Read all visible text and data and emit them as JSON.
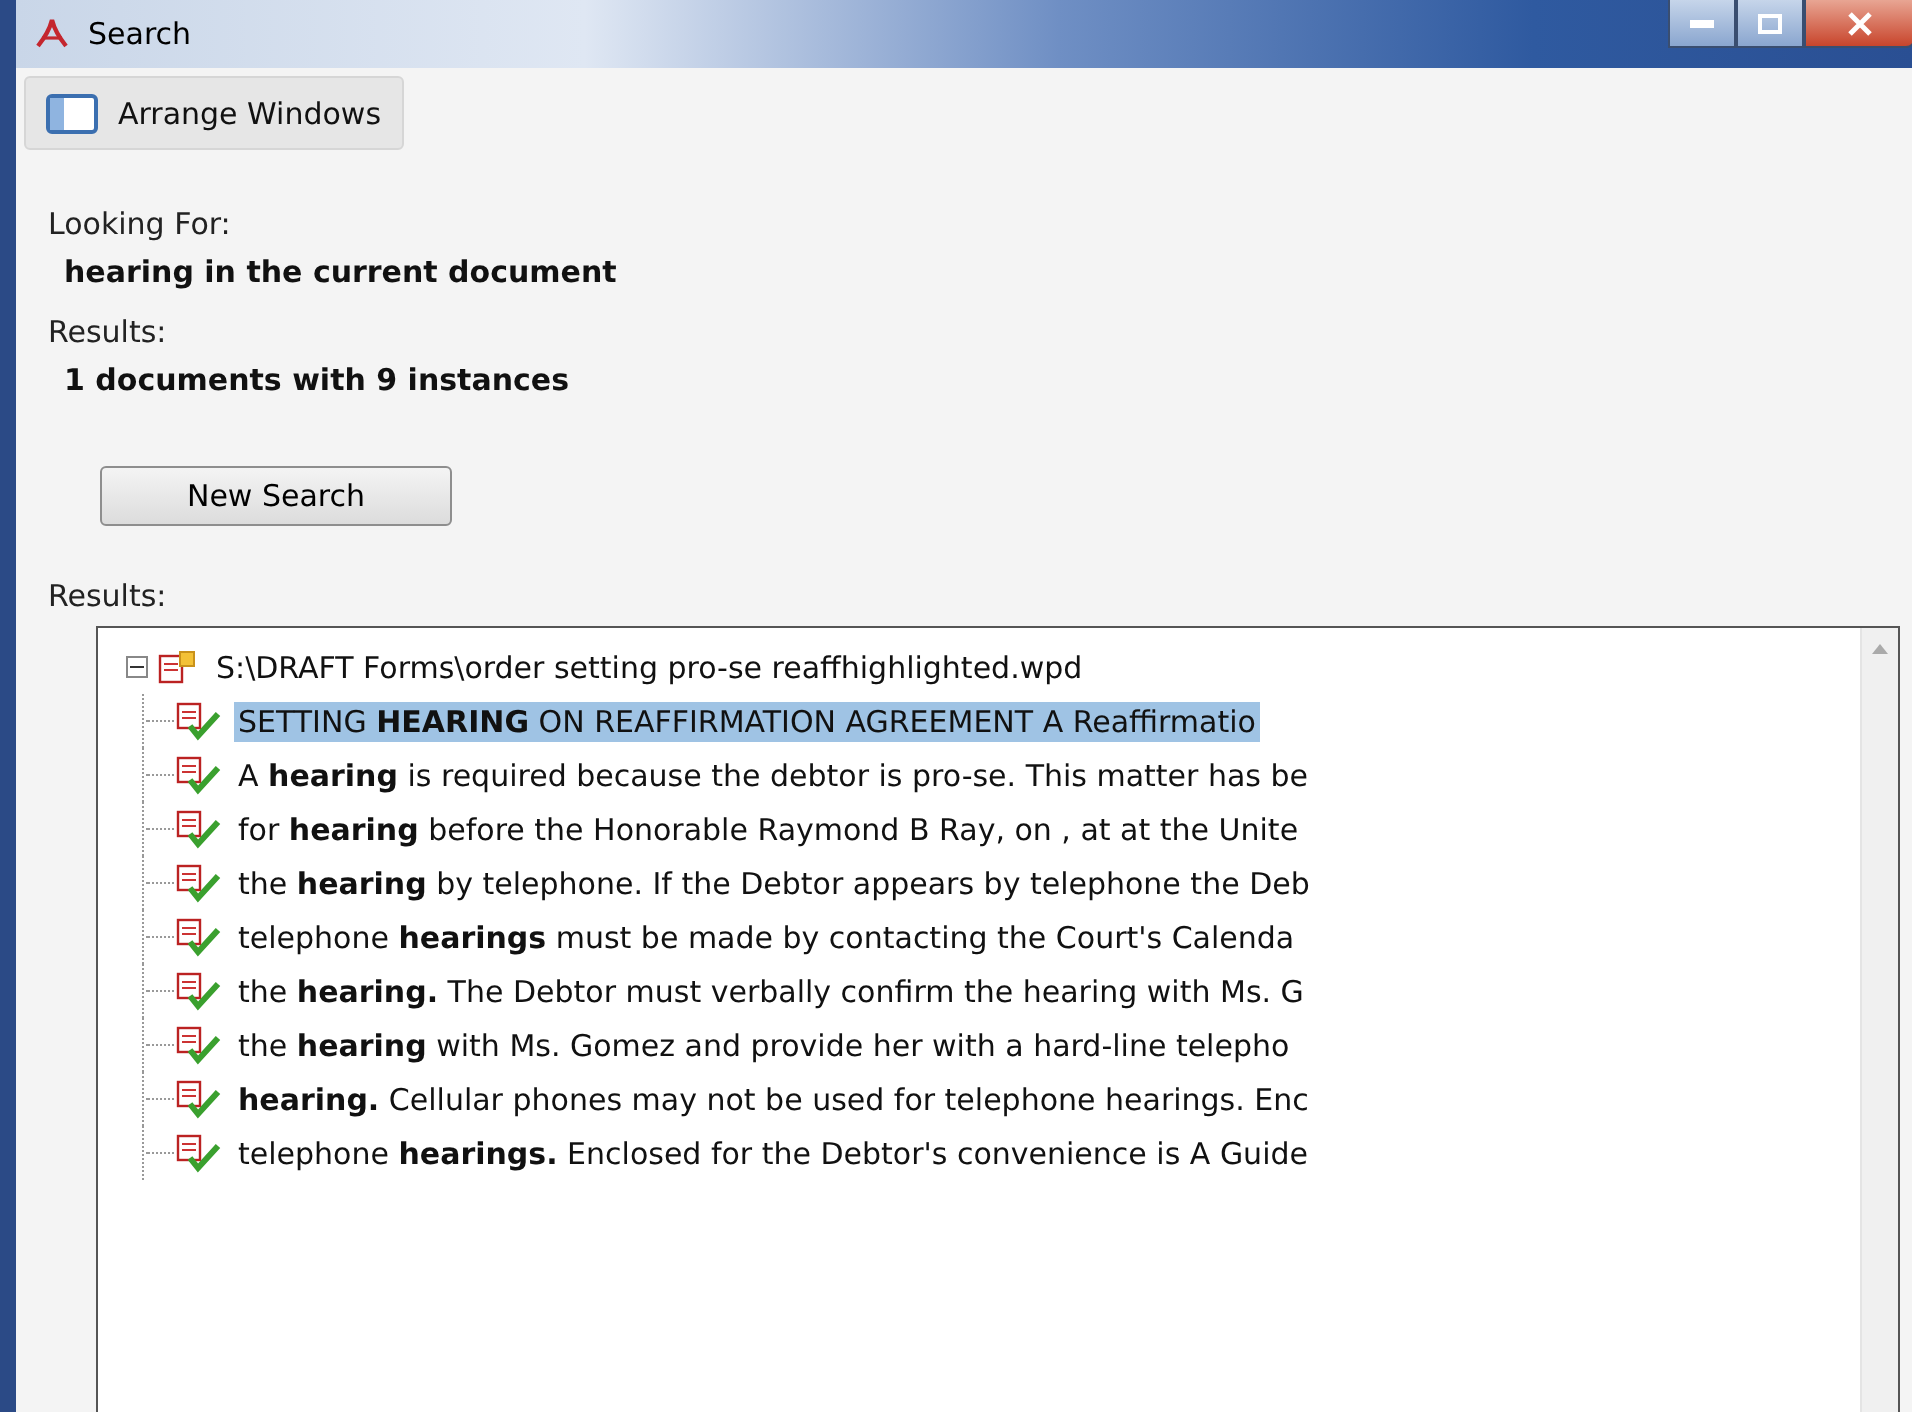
{
  "window": {
    "title": "Search"
  },
  "toolbar": {
    "arrange_button": "Arrange Windows"
  },
  "looking_for": {
    "label": "Looking For:",
    "value": "hearing in the current document"
  },
  "summary": {
    "label": "Results:",
    "value": "1 documents with 9 instances"
  },
  "new_search_button": "New Search",
  "results": {
    "label": "Results:",
    "tree": {
      "label": "S:\\DRAFT Forms\\order setting pro-se reaffhighlighted.wpd",
      "expanded": true,
      "children": [
        {
          "text": "SETTING **HEARING** ON REAFFIRMATION AGREEMENT A Reaffirmatio",
          "selected": true
        },
        {
          "text": "A **hearing** is required because the debtor is pro-se. This matter has be",
          "selected": false
        },
        {
          "text": "for **hearing** before the Honorable Raymond B Ray, on , at at the Unite",
          "selected": false
        },
        {
          "text": "the **hearing** by telephone. If the Debtor appears by telephone the Deb",
          "selected": false
        },
        {
          "text": "telephone **hearings** must be made by contacting the Court's Calenda",
          "selected": false
        },
        {
          "text": "the **hearing.** The Debtor must verbally confirm the hearing with Ms. G",
          "selected": false
        },
        {
          "text": "the **hearing** with Ms. Gomez and provide her with a hard-line telepho",
          "selected": false
        },
        {
          "text": "**hearing.** Cellular phones may not be used for telephone hearings. Enc",
          "selected": false
        },
        {
          "text": "telephone **hearings.** Enclosed for the Debtor's convenience is A Guide",
          "selected": false
        }
      ]
    }
  }
}
